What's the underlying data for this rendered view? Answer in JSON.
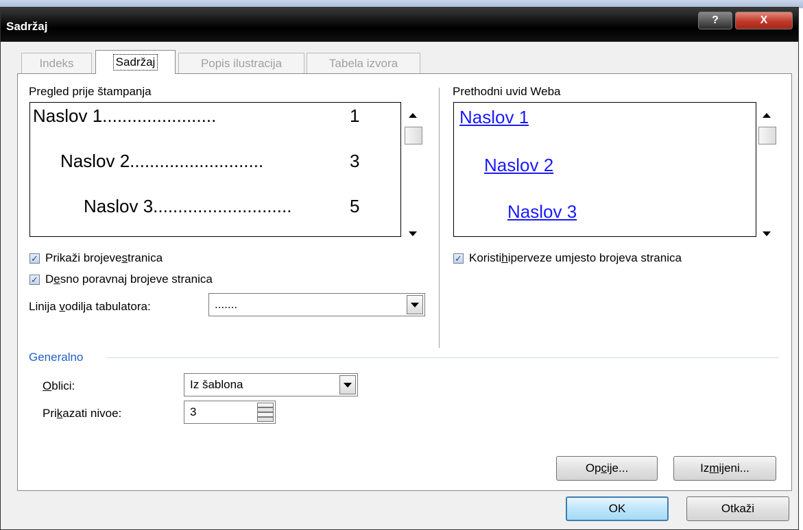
{
  "window": {
    "title": "Sadržaj",
    "help_label": "?",
    "close_label": "X"
  },
  "tabs": [
    {
      "label": "Indeks",
      "active": false
    },
    {
      "label": "Sadržaj",
      "active": true
    },
    {
      "label": "Popis ilustracija",
      "active": false
    },
    {
      "label": "Tabela izvora",
      "active": false
    }
  ],
  "print_preview": {
    "label": "Pregled prije štampanja",
    "entries": [
      {
        "text": "Naslov 1.......................",
        "page": "1"
      },
      {
        "text": "Naslov 2...........................",
        "page": "3"
      },
      {
        "text": "Naslov 3............................",
        "page": "5"
      }
    ]
  },
  "web_preview": {
    "label": "Prethodni uvid Weba",
    "links": [
      "Naslov 1",
      "Naslov 2",
      "Naslov 3"
    ]
  },
  "options": {
    "show_page_numbers": {
      "label_pre": "Prikaži brojeve ",
      "label_key": "s",
      "label_post": "tranica",
      "checked": true
    },
    "right_align": {
      "label_pre": "D",
      "label_key": "e",
      "label_post": "sno poravnaj brojeve stranica",
      "checked": true
    },
    "use_hyperlinks": {
      "label_pre": "Koristi ",
      "label_key": "h",
      "label_post": "iperveze umjesto brojeva stranica",
      "checked": true
    },
    "tab_leader": {
      "label_pre": "Linija ",
      "label_key": "v",
      "label_post": "odilja tabulatora:",
      "value": "......."
    }
  },
  "general": {
    "group_label": "Generalno",
    "formats": {
      "label_key": "O",
      "label_post": "blici:",
      "value": "Iz šablona"
    },
    "show_levels": {
      "label_pre": "Pri",
      "label_key": "k",
      "label_post": "azati nivoe:",
      "value": "3"
    }
  },
  "buttons": {
    "options": {
      "pre": "Op",
      "key": "c",
      "post": "ije..."
    },
    "modify": {
      "pre": "Iz",
      "key": "m",
      "post": "ijeni..."
    },
    "ok": "OK",
    "cancel": "Otkaži"
  },
  "colors": {
    "link": "#1a1aff",
    "group_label": "#1f5fc4",
    "default_button_border": "#3c7fb1"
  }
}
